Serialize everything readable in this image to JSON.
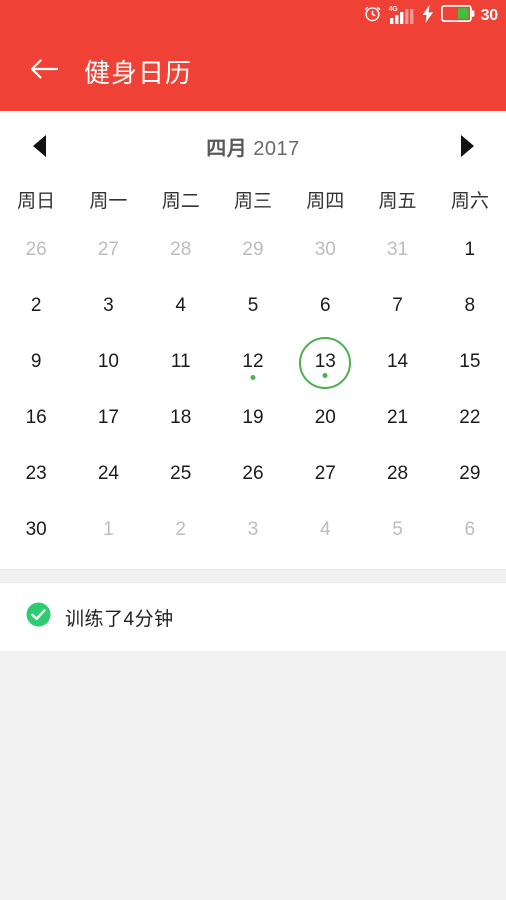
{
  "colors": {
    "brand_red": "#ef4136",
    "accent_green": "#4caf50",
    "check_green": "#2ecc71",
    "page_bg": "#f1f1f1",
    "card_bg": "#ffffff",
    "day_text": "#1b1b1b",
    "muted_day_text": "#bdbdbd"
  },
  "status_bar": {
    "alarm_icon": "alarm-clock-icon",
    "network_label": "4G",
    "signal_icon": "signal-bars-icon",
    "charging_icon": "lightning-bolt-icon",
    "battery_icon": "battery-icon",
    "battery_level": "30"
  },
  "app_bar": {
    "back_icon": "back-arrow-icon",
    "title": "健身日历"
  },
  "calendar": {
    "prev_icon": "triangle-left-icon",
    "next_icon": "triangle-right-icon",
    "month_label": "四月",
    "year_label": "2017",
    "weekdays": [
      "周日",
      "周一",
      "周二",
      "周三",
      "周四",
      "周五",
      "周六"
    ],
    "weeks": [
      [
        {
          "day": "26",
          "muted": true,
          "dot": false,
          "today": false
        },
        {
          "day": "27",
          "muted": true,
          "dot": false,
          "today": false
        },
        {
          "day": "28",
          "muted": true,
          "dot": false,
          "today": false
        },
        {
          "day": "29",
          "muted": true,
          "dot": false,
          "today": false
        },
        {
          "day": "30",
          "muted": true,
          "dot": false,
          "today": false
        },
        {
          "day": "31",
          "muted": true,
          "dot": false,
          "today": false
        },
        {
          "day": "1",
          "muted": false,
          "dot": false,
          "today": false
        }
      ],
      [
        {
          "day": "2",
          "muted": false,
          "dot": false,
          "today": false
        },
        {
          "day": "3",
          "muted": false,
          "dot": false,
          "today": false
        },
        {
          "day": "4",
          "muted": false,
          "dot": false,
          "today": false
        },
        {
          "day": "5",
          "muted": false,
          "dot": false,
          "today": false
        },
        {
          "day": "6",
          "muted": false,
          "dot": false,
          "today": false
        },
        {
          "day": "7",
          "muted": false,
          "dot": false,
          "today": false
        },
        {
          "day": "8",
          "muted": false,
          "dot": false,
          "today": false
        }
      ],
      [
        {
          "day": "9",
          "muted": false,
          "dot": false,
          "today": false
        },
        {
          "day": "10",
          "muted": false,
          "dot": false,
          "today": false
        },
        {
          "day": "11",
          "muted": false,
          "dot": false,
          "today": false
        },
        {
          "day": "12",
          "muted": false,
          "dot": true,
          "today": false
        },
        {
          "day": "13",
          "muted": false,
          "dot": true,
          "today": true
        },
        {
          "day": "14",
          "muted": false,
          "dot": false,
          "today": false
        },
        {
          "day": "15",
          "muted": false,
          "dot": false,
          "today": false
        }
      ],
      [
        {
          "day": "16",
          "muted": false,
          "dot": false,
          "today": false
        },
        {
          "day": "17",
          "muted": false,
          "dot": false,
          "today": false
        },
        {
          "day": "18",
          "muted": false,
          "dot": false,
          "today": false
        },
        {
          "day": "19",
          "muted": false,
          "dot": false,
          "today": false
        },
        {
          "day": "20",
          "muted": false,
          "dot": false,
          "today": false
        },
        {
          "day": "21",
          "muted": false,
          "dot": false,
          "today": false
        },
        {
          "day": "22",
          "muted": false,
          "dot": false,
          "today": false
        }
      ],
      [
        {
          "day": "23",
          "muted": false,
          "dot": false,
          "today": false
        },
        {
          "day": "24",
          "muted": false,
          "dot": false,
          "today": false
        },
        {
          "day": "25",
          "muted": false,
          "dot": false,
          "today": false
        },
        {
          "day": "26",
          "muted": false,
          "dot": false,
          "today": false
        },
        {
          "day": "27",
          "muted": false,
          "dot": false,
          "today": false
        },
        {
          "day": "28",
          "muted": false,
          "dot": false,
          "today": false
        },
        {
          "day": "29",
          "muted": false,
          "dot": false,
          "today": false
        }
      ],
      [
        {
          "day": "30",
          "muted": false,
          "dot": false,
          "today": false
        },
        {
          "day": "1",
          "muted": true,
          "dot": false,
          "today": false
        },
        {
          "day": "2",
          "muted": true,
          "dot": false,
          "today": false
        },
        {
          "day": "3",
          "muted": true,
          "dot": false,
          "today": false
        },
        {
          "day": "4",
          "muted": true,
          "dot": false,
          "today": false
        },
        {
          "day": "5",
          "muted": true,
          "dot": false,
          "today": false
        },
        {
          "day": "6",
          "muted": true,
          "dot": false,
          "today": false
        }
      ]
    ]
  },
  "summary": {
    "check_icon": "check-circle-icon",
    "text": "训练了4分钟"
  }
}
